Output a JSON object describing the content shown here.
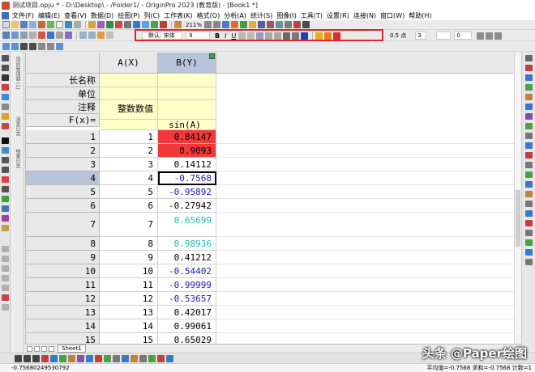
{
  "window": {
    "title": "测试项目.opju * - D:\\Desktop\\ - /Folder1/ - OriginPro 2023 (教育版) - [Book1 *]"
  },
  "menu": {
    "items": [
      "文件(F)",
      "编辑(E)",
      "查看(V)",
      "数据(D)",
      "绘图(P)",
      "列(C)",
      "工作表(K)",
      "格式(O)",
      "分析(A)",
      "统计(S)",
      "图像(I)",
      "工具(T)",
      "设置(R)",
      "连接(N)",
      "窗口(W)",
      "帮助(H)"
    ]
  },
  "toolbar": {
    "zoom": "211%",
    "font_name_prefix": "默认:",
    "font_name": "宋体",
    "font_size": "9",
    "line_width": "0.5 点",
    "spacing": "3",
    "border": "0"
  },
  "left_panel": {
    "tabs": [
      "项目管理器 (1)",
      "消息日志",
      "结果日志"
    ]
  },
  "worksheet": {
    "columns": [
      "A(X)",
      "B(Y)"
    ],
    "meta_labels": [
      "长名称",
      "单位",
      "注释",
      "F(x)="
    ],
    "meta_values": {
      "a_comment": "整数数值",
      "b_formula": "sin(A)"
    },
    "rows": [
      {
        "n": "1",
        "a": "1",
        "b": "0.84147"
      },
      {
        "n": "2",
        "a": "2",
        "b": "0.9093"
      },
      {
        "n": "3",
        "a": "3",
        "b": "0.14112"
      },
      {
        "n": "4",
        "a": "4",
        "b": "-0.7568"
      },
      {
        "n": "5",
        "a": "5",
        "b": "-0.95892"
      },
      {
        "n": "6",
        "a": "6",
        "b": "-0.27942"
      },
      {
        "n": "7",
        "a": "7",
        "b": "0.65699"
      },
      {
        "n": "8",
        "a": "8",
        "b": "0.98936"
      },
      {
        "n": "9",
        "a": "9",
        "b": "0.41212"
      },
      {
        "n": "10",
        "a": "10",
        "b": "-0.54402"
      },
      {
        "n": "11",
        "a": "11",
        "b": "-0.99999"
      },
      {
        "n": "12",
        "a": "12",
        "b": "-0.53657"
      },
      {
        "n": "13",
        "a": "13",
        "b": "0.42017"
      },
      {
        "n": "14",
        "a": "14",
        "b": "0.99061"
      },
      {
        "n": "15",
        "a": "15",
        "b": "0.65029"
      }
    ],
    "colors": {
      "highlight_red": "#f03a3a",
      "blue_text": "#1b1bb4",
      "cyan_text": "#22b6b6",
      "meta_yellow": "#ffffc8",
      "selected_row": "#b7c4d9"
    }
  },
  "sheet_tabs": [
    "Sheet1"
  ],
  "status": {
    "left": "-0.75680249530792",
    "right": "平均值=-0.7568 求和=-0.7568 计数=1"
  },
  "watermark": "头条 @Paper绘图"
}
